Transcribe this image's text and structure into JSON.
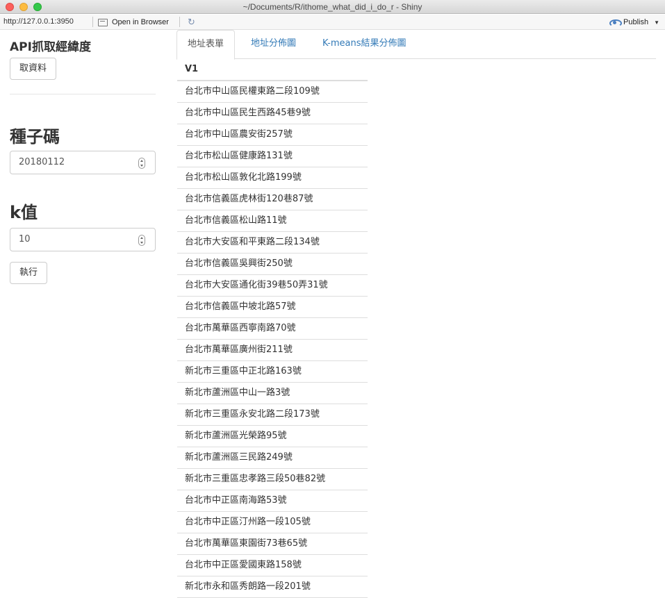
{
  "window": {
    "title": "~/Documents/R/ithome_what_did_i_do_r - Shiny"
  },
  "toolbar": {
    "url": "http://127.0.0.1:3950",
    "open_browser_label": "Open in Browser",
    "refresh_icon": "refresh-icon",
    "publish_label": "Publish"
  },
  "sidebar": {
    "api_heading": "API抓取經緯度",
    "fetch_button": "取資料",
    "seed_heading": "種子碼",
    "seed_value": "20180112",
    "k_heading": "k值",
    "k_value": "10",
    "run_button": "執行"
  },
  "tabs": [
    {
      "label": "地址表單",
      "active": true
    },
    {
      "label": "地址分佈圖",
      "active": false
    },
    {
      "label": "K-means結果分佈圖",
      "active": false
    }
  ],
  "table": {
    "header": "V1",
    "rows": [
      "台北市中山區民權東路二段109號",
      "台北市中山區民生西路45巷9號",
      "台北市中山區農安街257號",
      "台北市松山區健康路131號",
      "台北市松山區敦化北路199號",
      "台北市信義區虎林街120巷87號",
      "台北市信義區松山路11號",
      "台北市大安區和平東路二段134號",
      "台北市信義區吳興街250號",
      "台北市大安區通化街39巷50弄31號",
      "台北市信義區中坡北路57號",
      "台北市萬華區西寧南路70號",
      "台北市萬華區廣州街211號",
      "新北市三重區中正北路163號",
      "新北市蘆洲區中山一路3號",
      "新北市三重區永安北路二段173號",
      "新北市蘆洲區光榮路95號",
      "新北市蘆洲區三民路249號",
      "新北市三重區忠孝路三段50巷82號",
      "台北市中正區南海路53號",
      "台北市中正區汀州路一段105號",
      "台北市萬華區東園街73巷65號",
      "台北市中正區愛國東路158號",
      "新北市永和區秀朗路一段201號"
    ]
  }
}
